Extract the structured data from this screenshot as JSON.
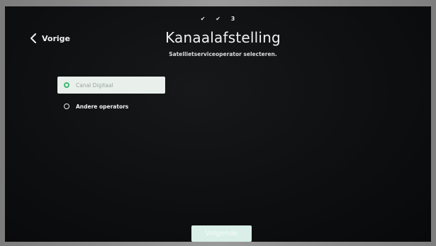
{
  "progress": {
    "steps": [
      "✔",
      "✔",
      "3"
    ]
  },
  "header": {
    "back_label": "Vorige",
    "title": "Kanaalafstelling",
    "subtitle": "Satellietserviceoperator selecteren."
  },
  "options": [
    {
      "label": "Canal Digitaal",
      "selected": true
    },
    {
      "label": "Andere operators",
      "selected": false
    }
  ],
  "footer": {
    "next_label": "Volgende"
  },
  "colors": {
    "accent": "#3fb873",
    "selection_bg": "#e9f0ec",
    "button_bg": "#d9efe8",
    "screen_bg": "#0e0f11"
  },
  "icons": {
    "back": "chevron-left-icon",
    "radio_on": "radio-selected-icon",
    "radio_off": "radio-unselected-icon"
  }
}
